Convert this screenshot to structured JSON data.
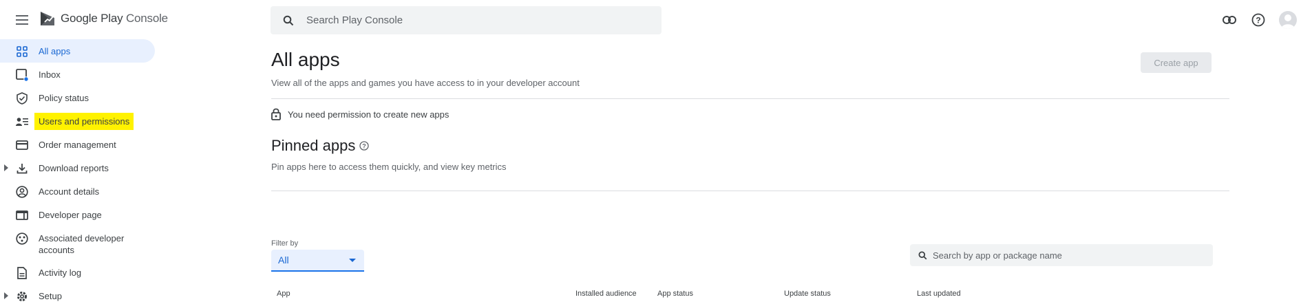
{
  "header": {
    "brand_google_play": "Google Play",
    "brand_console": "Console",
    "search_placeholder": "Search Play Console"
  },
  "sidebar": {
    "items": [
      {
        "label": "All apps",
        "icon": "grid-icon",
        "active": true
      },
      {
        "label": "Inbox",
        "icon": "inbox-icon"
      },
      {
        "label": "Policy status",
        "icon": "shield-check-icon"
      },
      {
        "label": "Users and permissions",
        "icon": "users-list-icon",
        "highlighted": true
      },
      {
        "label": "Order management",
        "icon": "credit-card-icon"
      },
      {
        "label": "Download reports",
        "icon": "download-icon",
        "expandable": true
      },
      {
        "label": "Account details",
        "icon": "account-circle-icon"
      },
      {
        "label": "Developer page",
        "icon": "web-page-icon"
      },
      {
        "label": "Associated developer accounts",
        "icon": "linked-accounts-icon"
      },
      {
        "label": "Activity log",
        "icon": "document-icon"
      },
      {
        "label": "Setup",
        "icon": "gear-icon",
        "expandable": true
      }
    ]
  },
  "main": {
    "title": "All apps",
    "subtitle": "View all of the apps and games you have access to in your developer account",
    "create_button": "Create app",
    "permission_notice": "You need permission to create new apps",
    "pinned_title": "Pinned apps",
    "pinned_subtitle": "Pin apps here to access them quickly, and view key metrics",
    "filter_label": "Filter by",
    "filter_value": "All",
    "app_search_placeholder": "Search by app or package name",
    "table_columns": [
      "App",
      "Installed audience",
      "App status",
      "Update status",
      "Last updated"
    ]
  },
  "colors": {
    "accent": "#1a73e8",
    "active_bg": "#e8f0fe",
    "highlight": "#fff200"
  }
}
